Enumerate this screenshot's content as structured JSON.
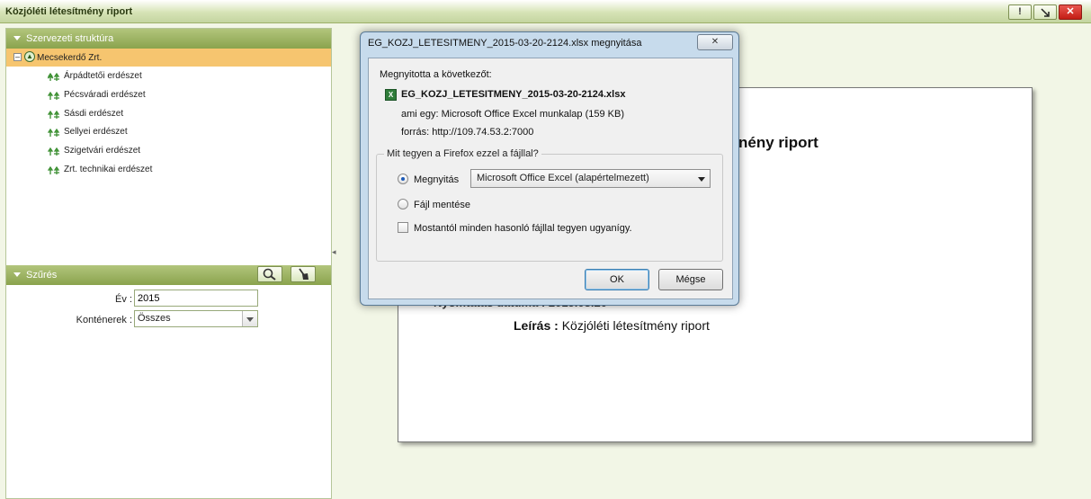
{
  "window": {
    "title": "Közjóléti létesítmény riport",
    "buttons": {
      "help": "!",
      "minimize": "",
      "close": "✕"
    }
  },
  "sidebar": {
    "structure_header": "Szervezeti struktúra",
    "root": "Mecsekerdő Zrt.",
    "items": [
      "Árpádtetői erdészet",
      "Pécsváradi erdészet",
      "Sásdi erdészet",
      "Sellyei erdészet",
      "Szigetvári erdészet",
      "Zrt. technikai erdészet"
    ]
  },
  "filter": {
    "header": "Szűrés",
    "year_label": "Év :",
    "year_value": "2015",
    "containers_label": "Konténerek :",
    "containers_value": "Összes"
  },
  "report": {
    "title_fragment": "nény riport",
    "print_date_fragment": "Nyomtatás dátuma : 2015.03.20",
    "desc_label": "Leírás :",
    "desc_value": "Közjóléti létesítmény riport"
  },
  "dialog": {
    "title": "EG_KOZJ_LETESITMENY_2015-03-20-2124.xlsx megnyitása",
    "close_label": "✕",
    "opening_label": "Megnyitotta a következőt:",
    "filename": "EG_KOZJ_LETESITMENY_2015-03-20-2124.xlsx",
    "type_line": "ami egy: Microsoft Office Excel munkalap (159 KB)",
    "source_line": "forrás: http://109.74.53.2:7000",
    "question": "Mit tegyen a Firefox ezzel a fájllal?",
    "open_with_label": "Megnyitás",
    "open_with_app": "Microsoft Office Excel (alapértelmezett)",
    "save_label": "Fájl mentése",
    "remember_label": "Mostantól minden hasonló fájllal tegyen ugyanígy.",
    "ok_label": "OK",
    "cancel_label": "Mégse"
  }
}
